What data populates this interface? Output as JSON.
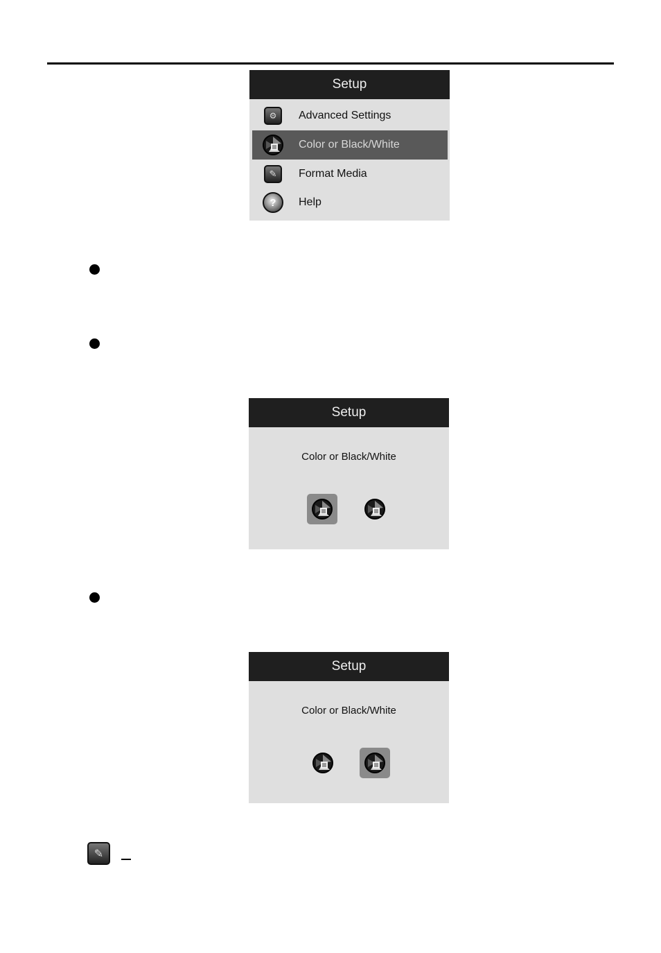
{
  "menu_panel": {
    "title": "Setup",
    "items": [
      {
        "label": "Advanced Settings",
        "icon": "advanced-settings-icon",
        "selected": false
      },
      {
        "label": "Color or Black/White",
        "icon": "color-mode-icon",
        "selected": true
      },
      {
        "label": "Format Media",
        "icon": "format-media-icon",
        "selected": false
      },
      {
        "label": "Help",
        "icon": "help-icon",
        "selected": false
      }
    ]
  },
  "color_panel_1": {
    "title": "Setup",
    "subtitle": "Color or Black/White",
    "selected_option": "color"
  },
  "color_panel_2": {
    "title": "Setup",
    "subtitle": "Color or Black/White",
    "selected_option": "black-white"
  },
  "footer": {
    "dash": "–"
  }
}
